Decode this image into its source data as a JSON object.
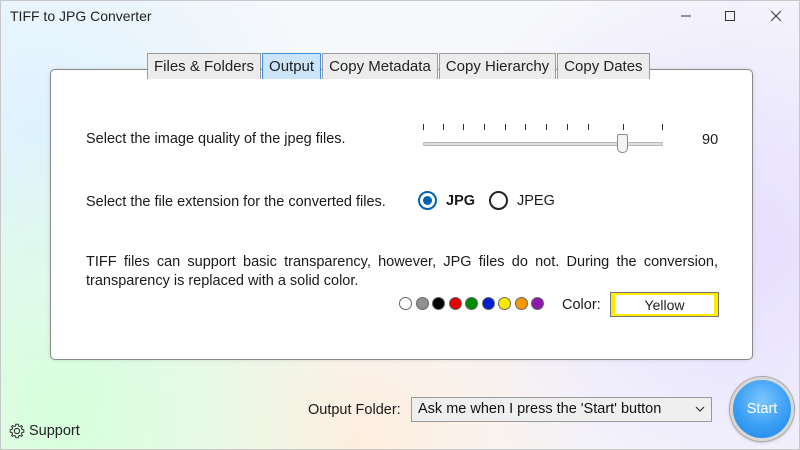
{
  "window": {
    "title": "TIFF to JPG Converter",
    "minimize_glyph": "—",
    "maximize_glyph": "☐",
    "close_glyph": "✕"
  },
  "tabs": [
    {
      "label": "Files & Folders",
      "active": false
    },
    {
      "label": "Output",
      "active": true
    },
    {
      "label": "Copy Metadata",
      "active": false
    },
    {
      "label": "Copy Hierarchy",
      "active": false
    },
    {
      "label": "Copy Dates",
      "active": false
    }
  ],
  "output": {
    "quality_label": "Select the image quality of the jpeg files.",
    "quality_value": "90",
    "slider": {
      "min": 0,
      "max": 100,
      "value": 90,
      "tick_count": 11
    },
    "extension_label": "Select the file extension for the converted files.",
    "extension_options": [
      {
        "label": "JPG",
        "checked": true
      },
      {
        "label": "JPEG",
        "checked": false
      }
    ],
    "transparency_text": "TIFF files can support basic transparency, however, JPG files do not. During the conversion, transparency is replaced with a solid color.",
    "swatches": [
      "#ffffff",
      "#909090",
      "#000000",
      "#e00000",
      "#008a00",
      "#0020d0",
      "#ffe800",
      "#f59a00",
      "#8a1aa8"
    ],
    "color_label": "Color:",
    "color_value": "Yellow",
    "color_hex": "#ffea00"
  },
  "footer": {
    "support_label": "Support",
    "output_folder_label": "Output Folder:",
    "output_folder_value": "Ask me when I press the 'Start' button",
    "start_label": "Start"
  },
  "colors": {
    "accent": "#0063b1",
    "tab_active_bg": "#cce4f7",
    "start_button": "#3a9ef3"
  }
}
